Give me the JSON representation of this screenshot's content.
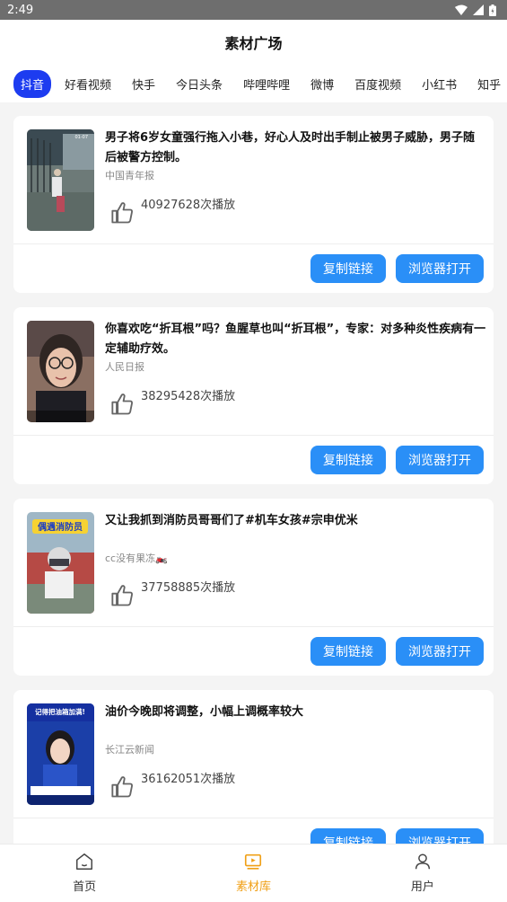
{
  "status": {
    "time": "2:49"
  },
  "header": {
    "title": "素材广场"
  },
  "tabs": [
    {
      "label": "抖音",
      "active": true
    },
    {
      "label": "好看视频",
      "active": false
    },
    {
      "label": "快手",
      "active": false
    },
    {
      "label": "今日头条",
      "active": false
    },
    {
      "label": "哔哩哔哩",
      "active": false
    },
    {
      "label": "微博",
      "active": false
    },
    {
      "label": "百度视频",
      "active": false
    },
    {
      "label": "小红书",
      "active": false
    },
    {
      "label": "知乎",
      "active": false
    }
  ],
  "cards": [
    {
      "headline": "男子将6岁女童强行拖入小巷，好心人及时出手制止被男子威胁，男子随后被警方控制。",
      "source": "中国青年报",
      "plays": "40927628次播放",
      "copy_label": "复制链接",
      "open_label": "浏览器打开"
    },
    {
      "headline": "你喜欢吃“折耳根”吗？鱼腥草也叫“折耳根”，专家：对多种炎性疾病有一定辅助疗效。",
      "source": "人民日报",
      "plays": "38295428次播放",
      "copy_label": "复制链接",
      "open_label": "浏览器打开"
    },
    {
      "headline": "又让我抓到消防员哥哥们了#机车女孩#宗申优米",
      "source": "cc没有果冻🏍️",
      "plays": "37758885次播放",
      "copy_label": "复制链接",
      "open_label": "浏览器打开",
      "thumb_caption": "偶遇消防员"
    },
    {
      "headline": "油价今晚即将调整，小幅上调概率较大",
      "source": "长江云新闻",
      "plays": "36162051次播放",
      "copy_label": "复制链接",
      "open_label": "浏览器打开",
      "thumb_caption": "记得把油箱加满!"
    }
  ],
  "bottom_nav": [
    {
      "label": "首页",
      "icon": "home-icon",
      "active": false
    },
    {
      "label": "素材库",
      "icon": "video-library-icon",
      "active": true
    },
    {
      "label": "用户",
      "icon": "user-icon",
      "active": false
    }
  ],
  "colors": {
    "accent_blue": "#2a8ff7",
    "tab_active": "#1d3cf0",
    "nav_active": "#f0a017"
  }
}
